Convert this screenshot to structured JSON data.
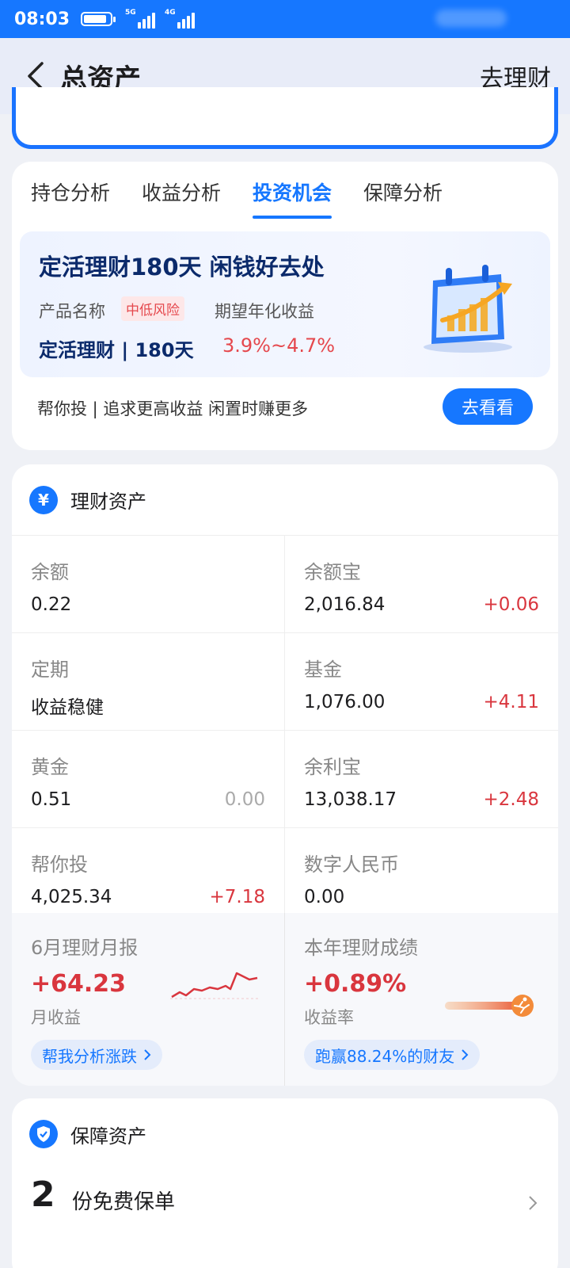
{
  "status_bar": {
    "time": "08:03",
    "net1": "5G",
    "net2": "4G"
  },
  "header": {
    "title": "总资产",
    "right_action": "去理财"
  },
  "tabs": [
    {
      "label": "持仓分析"
    },
    {
      "label": "收益分析"
    },
    {
      "label": "投资机会",
      "active": true
    },
    {
      "label": "保障分析"
    }
  ],
  "promo": {
    "title": "定活理财180天 闲钱好去处",
    "name_label": "产品名称",
    "risk_badge": "中低风险",
    "return_label": "期望年化收益",
    "product_name": "定活理财 | 180天",
    "return_range": "3.9%~4.7%",
    "footer": "帮你投 | 追求更高收益 闲置时赚更多",
    "button": "去看看"
  },
  "wealth_assets": {
    "section_icon": "¥",
    "title": "理财资产",
    "items": [
      {
        "label": "余额",
        "value": "0.22",
        "change": ""
      },
      {
        "label": "余额宝",
        "value": "2,016.84",
        "change": "+0.06"
      },
      {
        "label": "定期",
        "value": "收益稳健",
        "change": ""
      },
      {
        "label": "基金",
        "value": "1,076.00",
        "change": "+4.11"
      },
      {
        "label": "黄金",
        "value": "0.51",
        "change": "0.00"
      },
      {
        "label": "余利宝",
        "value": "13,038.17",
        "change": "+2.48"
      },
      {
        "label": "帮你投",
        "value": "4,025.34",
        "change": "+7.18"
      },
      {
        "label": "数字人民币",
        "value": "0.00",
        "change": ""
      }
    ],
    "monthly_report": {
      "label": "6月理财月报",
      "value": "+64.23",
      "sub": "月收益",
      "pill": "帮我分析涨跌"
    },
    "yearly_report": {
      "label": "本年理财成绩",
      "value": "+0.89%",
      "sub": "收益率",
      "pill": "跑赢88.24%的财友"
    }
  },
  "insurance": {
    "title": "保障资产",
    "count": "2",
    "text": "份免费保单"
  },
  "colors": {
    "brand_blue": "#1677ff",
    "gain_red": "#d9363e",
    "page_bg": "#eff1f6"
  }
}
